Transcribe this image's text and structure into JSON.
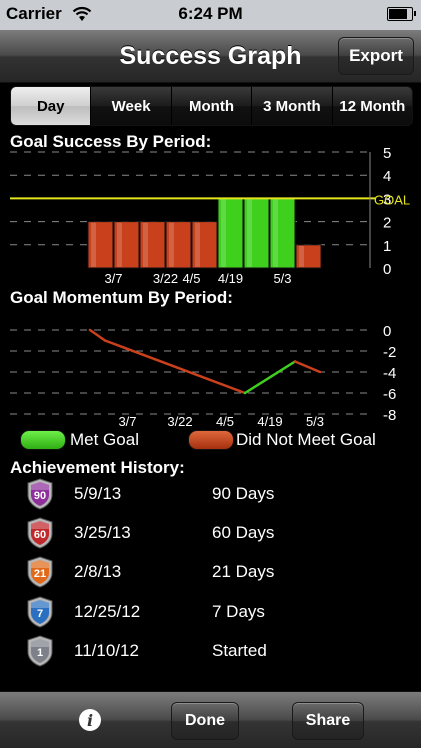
{
  "status": {
    "carrier": "Carrier",
    "time": "6:24 PM"
  },
  "nav": {
    "title": "Success Graph",
    "export_label": "Export"
  },
  "tabs": [
    "Day",
    "Week",
    "Month",
    "3 Month",
    "12 Month"
  ],
  "active_tab": "Day",
  "colors": {
    "met": "#3fd01e",
    "not_met": "#c9401c",
    "goal_line": "#e5e51e"
  },
  "chart_data": [
    {
      "type": "bar",
      "title": "Goal Success By Period:",
      "x": [
        1,
        2,
        3,
        4,
        5,
        6,
        7,
        8,
        9
      ],
      "values": [
        2,
        2,
        2,
        2,
        2,
        3,
        3,
        3,
        1
      ],
      "met": [
        false,
        false,
        false,
        false,
        false,
        true,
        true,
        true,
        false
      ],
      "tick_positions": [
        1.5,
        3.5,
        4.5,
        6,
        8
      ],
      "tick_labels": [
        "3/7",
        "3/22",
        "4/5",
        "4/19",
        "5/3"
      ],
      "ylim": [
        0,
        5
      ],
      "yticks": [
        0,
        1,
        2,
        3,
        4,
        5
      ],
      "goal_value": 3,
      "goal_label": "GOAL",
      "grid": true
    },
    {
      "type": "line",
      "title": "Goal Momentum By Period:",
      "x": [
        1,
        1.6,
        7.2,
        9.2,
        10.2
      ],
      "y": [
        0,
        -1,
        -6,
        -3,
        -4
      ],
      "segment_met": [
        false,
        false,
        true,
        false
      ],
      "tick_positions": [
        2.5,
        4.6,
        6.4,
        8.2,
        10
      ],
      "tick_labels": [
        "3/7",
        "3/22",
        "4/5",
        "4/19",
        "5/3"
      ],
      "ylim": [
        -8,
        0
      ],
      "yticks": [
        0,
        -2,
        -4,
        -6,
        -8
      ],
      "grid": true
    }
  ],
  "legend": {
    "met": "Met Goal",
    "not_met": "Did Not Meet Goal"
  },
  "history": {
    "title": "Achievement History:",
    "items": [
      {
        "badge": "90",
        "color": "#8e2f9c",
        "date": "5/9/13",
        "desc": "90 Days"
      },
      {
        "badge": "60",
        "color": "#c0282c",
        "date": "3/25/13",
        "desc": "60 Days"
      },
      {
        "badge": "21",
        "color": "#e06a1a",
        "date": "2/8/13",
        "desc": "21 Days"
      },
      {
        "badge": "7",
        "color": "#2a6fc0",
        "date": "12/25/12",
        "desc": "7 Days"
      },
      {
        "badge": "1",
        "color": "#7d8089",
        "date": "11/10/12",
        "desc": "Started"
      }
    ]
  },
  "toolbar": {
    "done_label": "Done",
    "share_label": "Share"
  }
}
